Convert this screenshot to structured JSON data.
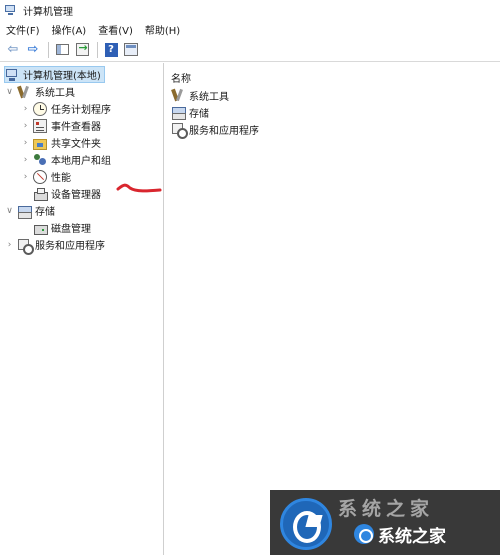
{
  "window": {
    "title": "计算机管理"
  },
  "menubar": {
    "items": [
      "文件(F)",
      "操作(A)",
      "查看(V)",
      "帮助(H)"
    ]
  },
  "toolbar": {
    "buttons": [
      "back-icon",
      "forward-icon",
      "show-hide-tree-icon",
      "export-list-icon",
      "help-icon",
      "view-icon"
    ]
  },
  "tree": {
    "root": "计算机管理(本地)",
    "items": [
      {
        "label": "系统工具",
        "expanded": true,
        "icon": "tools-icon"
      },
      {
        "label": "任务计划程序",
        "icon": "task-scheduler-icon"
      },
      {
        "label": "事件查看器",
        "icon": "event-viewer-icon"
      },
      {
        "label": "共享文件夹",
        "icon": "shared-folders-icon"
      },
      {
        "label": "本地用户和组",
        "icon": "users-groups-icon"
      },
      {
        "label": "性能",
        "icon": "performance-icon"
      },
      {
        "label": "设备管理器",
        "icon": "device-manager-icon"
      },
      {
        "label": "存储",
        "expanded": true,
        "icon": "storage-icon"
      },
      {
        "label": "磁盘管理",
        "icon": "disk-management-icon"
      },
      {
        "label": "服务和应用程序",
        "icon": "services-icon"
      }
    ]
  },
  "content": {
    "column_header": "名称",
    "rows": [
      "系统工具",
      "存储",
      "服务和应用程序"
    ]
  },
  "annotation": {
    "arrow_color": "#d9262e"
  },
  "watermark": {
    "upper_text": "系统之家",
    "lower_text": "系统之家"
  }
}
